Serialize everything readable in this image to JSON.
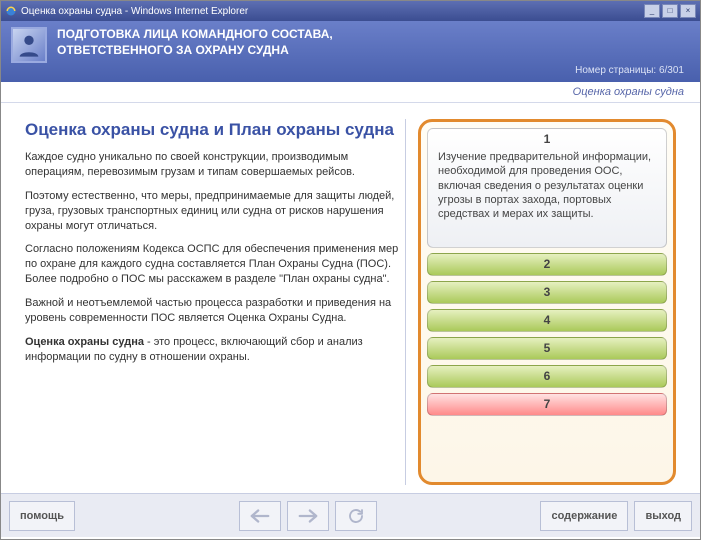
{
  "window": {
    "title": "Оценка охраны судна - Windows Internet Explorer"
  },
  "header": {
    "line1": "ПОДГОТОВКА ЛИЦА КОМАНДНОГО СОСТАВА,",
    "line2": "ОТВЕТСТВЕННОГО ЗА ОХРАНУ СУДНА",
    "page_num_label": "Номер страницы: 6/301"
  },
  "breadcrumb": "Оценка охраны судна",
  "content": {
    "title": "Оценка охраны судна и План охраны судна",
    "p1": "Каждое судно уникально по своей конструкции, производимым операциям, перевозимым грузам и типам совершаемых рейсов.",
    "p2": "Поэтому естественно, что меры, предпринимаемые для защиты людей, груза, грузовых транспортных единиц или судна от рисков нарушения охраны могут отличаться.",
    "p3": "Согласно положениям Кодекса ОСПС для обеспечения применения мер по охране для каждого судна составляется План Охраны Судна (ПОС). Более подробно о ПОС мы расскажем в разделе \"План охраны судна\".",
    "p4": "Важной и неотъемлемой частью процесса разработки и приведения на уровень современности ПОС является Оценка Охраны Судна.",
    "p5_bold": "Оценка охраны судна",
    "p5_rest": " - это процесс, включающий сбор и анализ информации по судну в отношении охраны."
  },
  "panel": {
    "items": [
      {
        "num": "1",
        "desc": "Изучение предварительной информации, необходимой для проведения ООС, включая сведения о результатах оценки угрозы в портах захода, портовых средствах и мерах их защиты."
      },
      {
        "num": "2"
      },
      {
        "num": "3"
      },
      {
        "num": "4"
      },
      {
        "num": "5"
      },
      {
        "num": "6"
      },
      {
        "num": "7"
      }
    ]
  },
  "footer": {
    "help": "помощь",
    "contents": "содержание",
    "exit": "выход"
  }
}
